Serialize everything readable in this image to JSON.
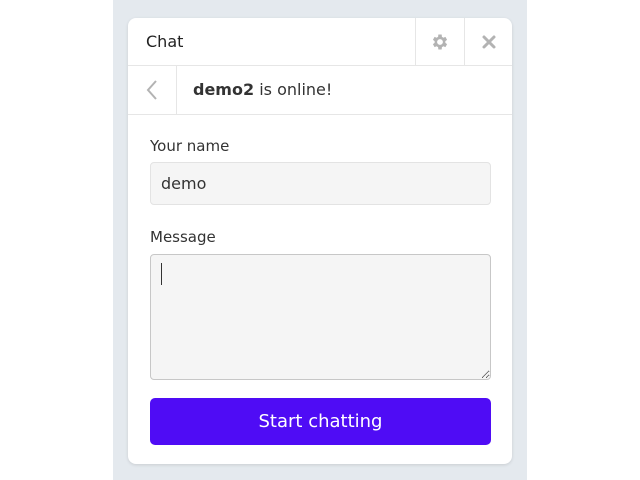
{
  "header": {
    "title": "Chat",
    "settings_icon": "gear-icon",
    "close_icon": "close-icon"
  },
  "status": {
    "back_icon": "chevron-left-icon",
    "username": "demo2",
    "suffix": " is online!"
  },
  "form": {
    "name_label": "Your name",
    "name_value": "demo",
    "message_label": "Message",
    "message_value": "",
    "submit_label": "Start chatting"
  },
  "colors": {
    "accent": "#4f0cf5",
    "backdrop": "#e4e9ee"
  }
}
